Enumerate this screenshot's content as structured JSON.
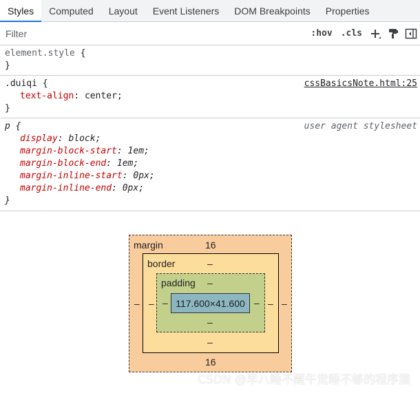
{
  "tabs": [
    {
      "label": "Styles",
      "active": true
    },
    {
      "label": "Computed",
      "active": false
    },
    {
      "label": "Layout",
      "active": false
    },
    {
      "label": "Event Listeners",
      "active": false
    },
    {
      "label": "DOM Breakpoints",
      "active": false
    },
    {
      "label": "Properties",
      "active": false
    }
  ],
  "toolbar": {
    "filter_placeholder": "Filter",
    "hov_label": ":hov",
    "cls_label": ".cls",
    "icons": [
      "plus-icon",
      "paint-format-icon",
      "toggle-sidebar-icon"
    ]
  },
  "rules": {
    "element_style": {
      "selector": "element.style",
      "open": "{",
      "close": "}"
    },
    "duiqi": {
      "selector": ".duiqi",
      "open": "{",
      "close": "}",
      "source": "cssBasicsNote.html:25",
      "decl0_name": "text-align",
      "decl0_value": "center"
    },
    "p": {
      "selector": "p",
      "open": "{",
      "close": "}",
      "source": "user agent stylesheet",
      "decl0_name": "display",
      "decl0_value": "block",
      "decl1_name": "margin-block-start",
      "decl1_value": "1em",
      "decl2_name": "margin-block-end",
      "decl2_value": "1em",
      "decl3_name": "margin-inline-start",
      "decl3_value": "0px",
      "decl4_name": "margin-inline-end",
      "decl4_value": "0px"
    }
  },
  "punct": {
    "colon": ": ",
    "semicolon": ";"
  },
  "box_model": {
    "margin_label": "margin",
    "margin_top": "16",
    "margin_bottom": "16",
    "margin_left": "–",
    "margin_right": "–",
    "border_label": "border",
    "border_top": "–",
    "border_bottom": "–",
    "border_left": "–",
    "border_right": "–",
    "padding_label": "padding",
    "padding_top": "–",
    "padding_bottom": "–",
    "padding_left": "–",
    "padding_right": "–",
    "content_size": "117.600×41.600"
  },
  "watermark": "CSDN @早八睡不醒午觉睡不够的程序猿",
  "colors": {
    "margin": "#f9cc9d",
    "border": "#fddd9b",
    "padding": "#c3d08b",
    "content": "#8cb6c0",
    "property_name": "#c80000",
    "active_tab_indicator": "#1a73e8"
  }
}
